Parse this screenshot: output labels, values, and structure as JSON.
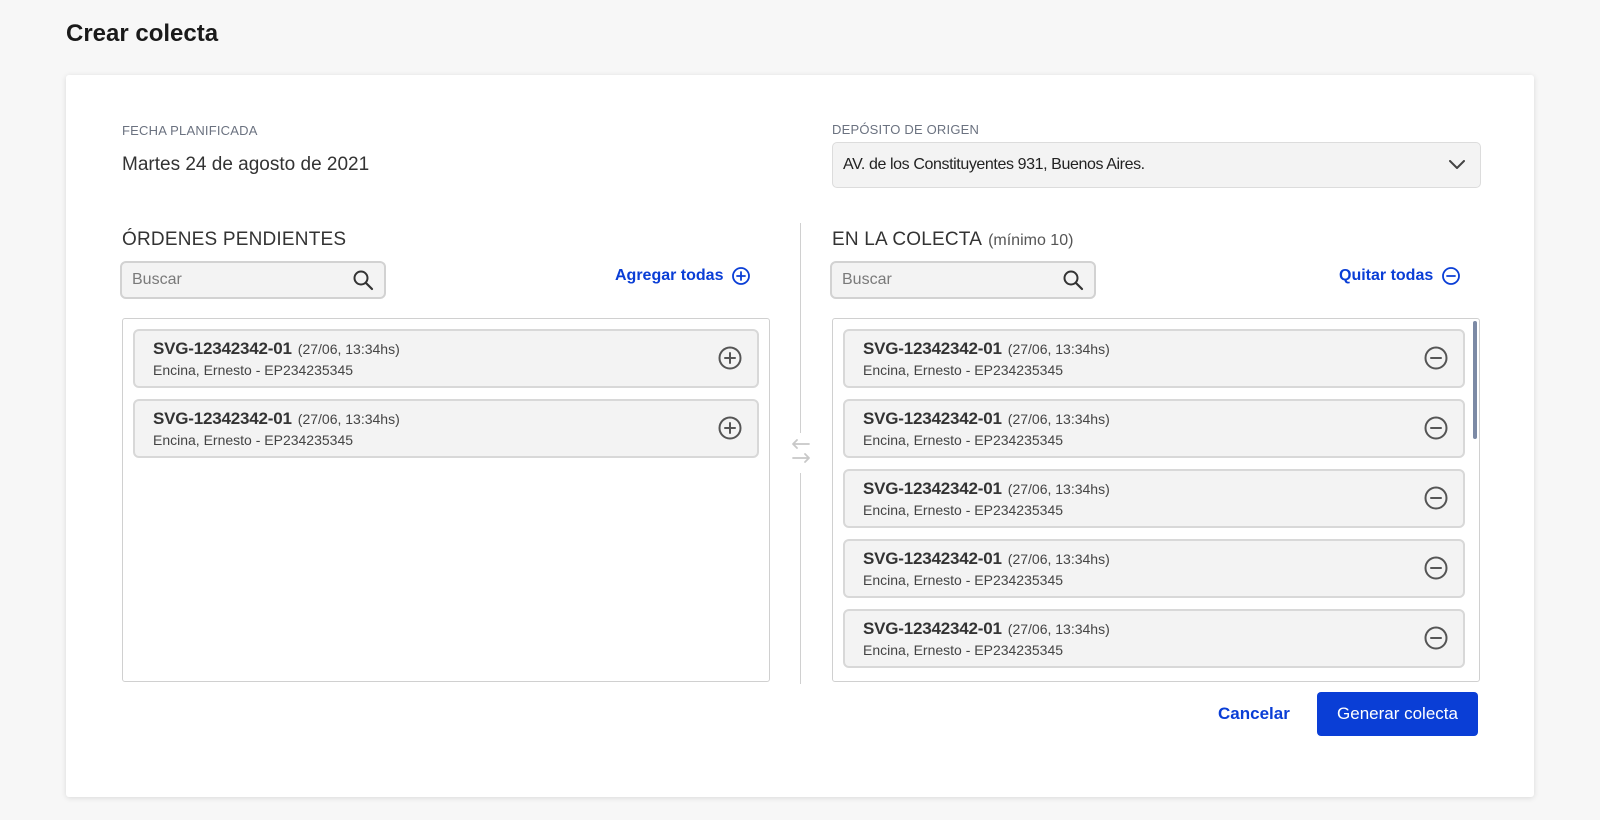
{
  "page": {
    "title": "Crear colecta"
  },
  "planned_date": {
    "label": "FECHA PLANIFICADA",
    "value": "Martes 24 de agosto de 2021"
  },
  "origin": {
    "label": "DEPÓSITO DE ORIGEN",
    "selected": "AV. de los Constituyentes 931, Buenos Aires."
  },
  "pending": {
    "title": "ÓRDENES PENDIENTES",
    "search_placeholder": "Buscar",
    "add_all_label": "Agregar todas",
    "items": [
      {
        "code": "SVG-12342342-01",
        "date": "(27/06, 13:34hs)",
        "detail": "Encina, Ernesto - EP234235345"
      },
      {
        "code": "SVG-12342342-01",
        "date": "(27/06, 13:34hs)",
        "detail": "Encina, Ernesto - EP234235345"
      }
    ]
  },
  "collection": {
    "title": "EN LA COLECTA",
    "subtitle": "(mínimo 10)",
    "search_placeholder": "Buscar",
    "remove_all_label": "Quitar todas",
    "items": [
      {
        "code": "SVG-12342342-01",
        "date": "(27/06, 13:34hs)",
        "detail": "Encina, Ernesto - EP234235345"
      },
      {
        "code": "SVG-12342342-01",
        "date": "(27/06, 13:34hs)",
        "detail": "Encina, Ernesto - EP234235345"
      },
      {
        "code": "SVG-12342342-01",
        "date": "(27/06, 13:34hs)",
        "detail": "Encina, Ernesto - EP234235345"
      },
      {
        "code": "SVG-12342342-01",
        "date": "(27/06, 13:34hs)",
        "detail": "Encina, Ernesto - EP234235345"
      },
      {
        "code": "SVG-12342342-01",
        "date": "(27/06, 13:34hs)",
        "detail": "Encina, Ernesto - EP234235345"
      }
    ]
  },
  "actions": {
    "cancel_label": "Cancelar",
    "submit_label": "Generar colecta"
  },
  "colors": {
    "accent": "#0a3ed6",
    "item_bg": "#f3f3f3",
    "border": "#d0d0d0"
  },
  "icons": {
    "add": "plus-circle-icon",
    "remove": "minus-circle-icon",
    "search": "search-icon",
    "swap": "swap-arrows-icon",
    "dropdown": "chevron-down-icon"
  }
}
